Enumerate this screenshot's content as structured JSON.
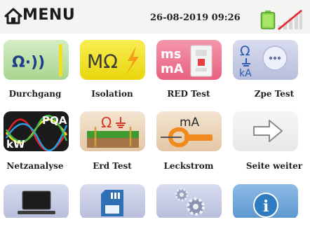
{
  "header": {
    "title": "MENU",
    "datetime": "26-08-2019 09:26"
  },
  "icons": {
    "home": "home-icon",
    "battery": "battery-icon",
    "signal": "no-signal-icon"
  },
  "tiles": [
    {
      "label": "Durchgang",
      "icon": "continuity-icon",
      "text": "Ω·))"
    },
    {
      "label": "Isolation",
      "icon": "insulation-icon",
      "text": "MΩ"
    },
    {
      "label": "RED Test",
      "icon": "rcd-test-icon",
      "text_top": "ms",
      "text_bottom": "mA"
    },
    {
      "label": "Zpe Test",
      "icon": "loop-impedance-icon",
      "text_top": "Ω",
      "text_bottom": "kA"
    },
    {
      "label": "Netzanalyse",
      "icon": "power-quality-icon",
      "text_top": "PQA",
      "text_bottom": "kW"
    },
    {
      "label": "Erd Test",
      "icon": "earth-test-icon",
      "text": "Ω"
    },
    {
      "label": "Leckstrom",
      "icon": "leakage-clamp-icon",
      "text": "mA"
    },
    {
      "label": "Seite weiter",
      "icon": "next-page-arrow-icon"
    },
    {
      "label": "",
      "icon": "monitor-icon"
    },
    {
      "label": "",
      "icon": "memory-card-icon"
    },
    {
      "label": "",
      "icon": "settings-gears-icon"
    },
    {
      "label": "",
      "icon": "info-icon",
      "text": "i"
    }
  ],
  "colors": {
    "accent_yellow": "#f2e11c",
    "accent_pink": "#ee6e8e",
    "accent_blue": "#2f7bc2",
    "tile_lavender": "#c6cbe3",
    "tile_beige": "#ecd7bf"
  }
}
